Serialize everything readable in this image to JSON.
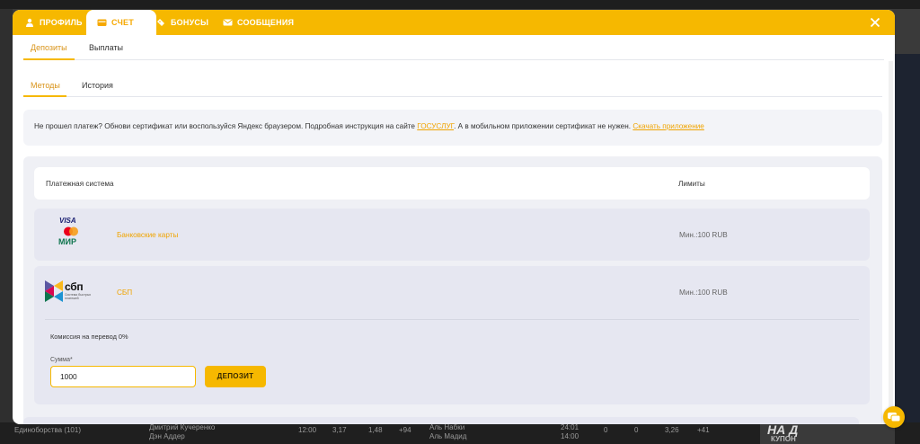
{
  "colors": {
    "accent": "#f6b800",
    "link": "#f0a400",
    "panel": "#eff0f5",
    "row": "#e6e7f1"
  },
  "header": {
    "tabs": [
      {
        "label": "ПРОФИЛЬ",
        "icon": "user-icon",
        "active": false
      },
      {
        "label": "СЧЕТ",
        "icon": "wallet-icon",
        "active": true
      },
      {
        "label": "БОНУСЫ",
        "icon": "ticket-icon",
        "active": false
      },
      {
        "label": "СООБЩЕНИЯ",
        "icon": "envelope-icon",
        "active": false
      }
    ],
    "close_icon": "close-icon"
  },
  "subnav": {
    "items": [
      "Депозиты",
      "Выплаты"
    ],
    "active_index": 0
  },
  "tabs2": {
    "items": [
      "Методы",
      "История"
    ],
    "active_index": 0
  },
  "notice": {
    "text_before": "Не прошел платеж? Обнови сертификат или воспользуйся Яндекс браузером. Подробная инструкция на сайте ",
    "link1": "ГОСУСЛУГ",
    "text_middle": ". А в мобильном приложении сертификат не нужен. ",
    "link2": "Скачать приложение"
  },
  "table": {
    "col_system": "Платежная система",
    "col_limits": "Лимиты",
    "rows": [
      {
        "name": "Банковские карты",
        "limit_label": "Мин.:",
        "limit_value": "100 RUB",
        "logo": "visa-mastercard-mir-logo",
        "logo_text": [
          "VISA",
          "МИР"
        ]
      },
      {
        "name": "СБП",
        "limit_label": "Мин.:",
        "limit_value": "100 RUB",
        "logo": "sbp-logo",
        "logo_text": [
          "сбп",
          "Система быстрых платежей"
        ]
      }
    ],
    "expanded": {
      "fee": "Комиссия на перевод 0%",
      "sum_label": "Сумма*",
      "sum_value": "1000",
      "deposit_button": "ДЕПОЗИТ"
    }
  },
  "chat_icon": "chat-icon",
  "background": {
    "bottom_left": "Единоборства (101)",
    "players_a": [
      "Дмитрий Кучеренко",
      "Дэн Аддер"
    ],
    "times": [
      "12:00",
      "14:00"
    ],
    "odds_a": [
      "3,17",
      "1,48",
      "+94"
    ],
    "players_b": [
      "Аль Набки",
      "Аль Мадид"
    ],
    "scores": [
      "24:01",
      "14:00"
    ],
    "odds_b": [
      "0",
      "0",
      "3,26",
      "+41"
    ],
    "kupon": "КУПОН",
    "promo": "НА Д"
  }
}
